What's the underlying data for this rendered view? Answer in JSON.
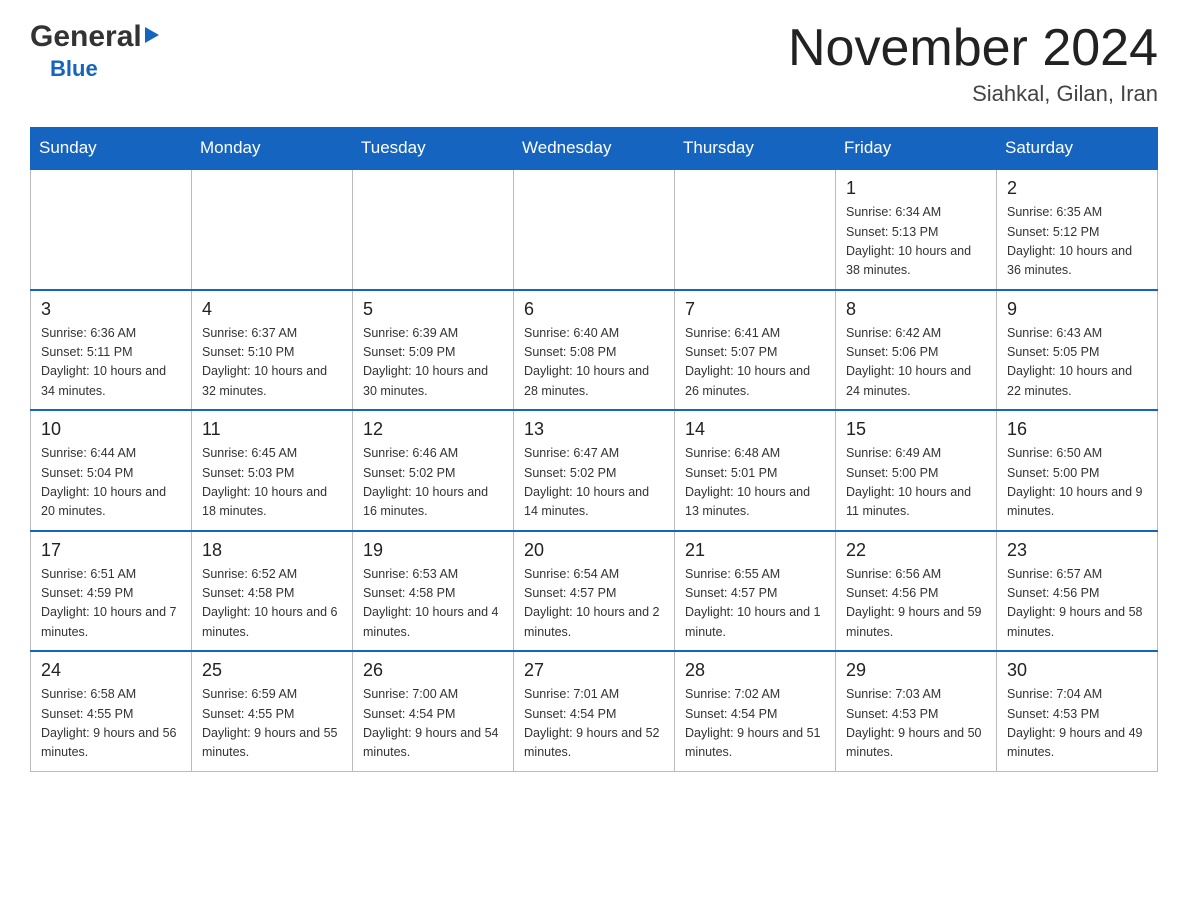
{
  "header": {
    "logo_general": "General",
    "logo_blue": "Blue",
    "month_title": "November 2024",
    "location": "Siahkal, Gilan, Iran"
  },
  "days_of_week": [
    "Sunday",
    "Monday",
    "Tuesday",
    "Wednesday",
    "Thursday",
    "Friday",
    "Saturday"
  ],
  "weeks": [
    {
      "days": [
        {
          "num": "",
          "info": ""
        },
        {
          "num": "",
          "info": ""
        },
        {
          "num": "",
          "info": ""
        },
        {
          "num": "",
          "info": ""
        },
        {
          "num": "",
          "info": ""
        },
        {
          "num": "1",
          "info": "Sunrise: 6:34 AM\nSunset: 5:13 PM\nDaylight: 10 hours\nand 38 minutes."
        },
        {
          "num": "2",
          "info": "Sunrise: 6:35 AM\nSunset: 5:12 PM\nDaylight: 10 hours\nand 36 minutes."
        }
      ]
    },
    {
      "days": [
        {
          "num": "3",
          "info": "Sunrise: 6:36 AM\nSunset: 5:11 PM\nDaylight: 10 hours\nand 34 minutes."
        },
        {
          "num": "4",
          "info": "Sunrise: 6:37 AM\nSunset: 5:10 PM\nDaylight: 10 hours\nand 32 minutes."
        },
        {
          "num": "5",
          "info": "Sunrise: 6:39 AM\nSunset: 5:09 PM\nDaylight: 10 hours\nand 30 minutes."
        },
        {
          "num": "6",
          "info": "Sunrise: 6:40 AM\nSunset: 5:08 PM\nDaylight: 10 hours\nand 28 minutes."
        },
        {
          "num": "7",
          "info": "Sunrise: 6:41 AM\nSunset: 5:07 PM\nDaylight: 10 hours\nand 26 minutes."
        },
        {
          "num": "8",
          "info": "Sunrise: 6:42 AM\nSunset: 5:06 PM\nDaylight: 10 hours\nand 24 minutes."
        },
        {
          "num": "9",
          "info": "Sunrise: 6:43 AM\nSunset: 5:05 PM\nDaylight: 10 hours\nand 22 minutes."
        }
      ]
    },
    {
      "days": [
        {
          "num": "10",
          "info": "Sunrise: 6:44 AM\nSunset: 5:04 PM\nDaylight: 10 hours\nand 20 minutes."
        },
        {
          "num": "11",
          "info": "Sunrise: 6:45 AM\nSunset: 5:03 PM\nDaylight: 10 hours\nand 18 minutes."
        },
        {
          "num": "12",
          "info": "Sunrise: 6:46 AM\nSunset: 5:02 PM\nDaylight: 10 hours\nand 16 minutes."
        },
        {
          "num": "13",
          "info": "Sunrise: 6:47 AM\nSunset: 5:02 PM\nDaylight: 10 hours\nand 14 minutes."
        },
        {
          "num": "14",
          "info": "Sunrise: 6:48 AM\nSunset: 5:01 PM\nDaylight: 10 hours\nand 13 minutes."
        },
        {
          "num": "15",
          "info": "Sunrise: 6:49 AM\nSunset: 5:00 PM\nDaylight: 10 hours\nand 11 minutes."
        },
        {
          "num": "16",
          "info": "Sunrise: 6:50 AM\nSunset: 5:00 PM\nDaylight: 10 hours\nand 9 minutes."
        }
      ]
    },
    {
      "days": [
        {
          "num": "17",
          "info": "Sunrise: 6:51 AM\nSunset: 4:59 PM\nDaylight: 10 hours\nand 7 minutes."
        },
        {
          "num": "18",
          "info": "Sunrise: 6:52 AM\nSunset: 4:58 PM\nDaylight: 10 hours\nand 6 minutes."
        },
        {
          "num": "19",
          "info": "Sunrise: 6:53 AM\nSunset: 4:58 PM\nDaylight: 10 hours\nand 4 minutes."
        },
        {
          "num": "20",
          "info": "Sunrise: 6:54 AM\nSunset: 4:57 PM\nDaylight: 10 hours\nand 2 minutes."
        },
        {
          "num": "21",
          "info": "Sunrise: 6:55 AM\nSunset: 4:57 PM\nDaylight: 10 hours\nand 1 minute."
        },
        {
          "num": "22",
          "info": "Sunrise: 6:56 AM\nSunset: 4:56 PM\nDaylight: 9 hours\nand 59 minutes."
        },
        {
          "num": "23",
          "info": "Sunrise: 6:57 AM\nSunset: 4:56 PM\nDaylight: 9 hours\nand 58 minutes."
        }
      ]
    },
    {
      "days": [
        {
          "num": "24",
          "info": "Sunrise: 6:58 AM\nSunset: 4:55 PM\nDaylight: 9 hours\nand 56 minutes."
        },
        {
          "num": "25",
          "info": "Sunrise: 6:59 AM\nSunset: 4:55 PM\nDaylight: 9 hours\nand 55 minutes."
        },
        {
          "num": "26",
          "info": "Sunrise: 7:00 AM\nSunset: 4:54 PM\nDaylight: 9 hours\nand 54 minutes."
        },
        {
          "num": "27",
          "info": "Sunrise: 7:01 AM\nSunset: 4:54 PM\nDaylight: 9 hours\nand 52 minutes."
        },
        {
          "num": "28",
          "info": "Sunrise: 7:02 AM\nSunset: 4:54 PM\nDaylight: 9 hours\nand 51 minutes."
        },
        {
          "num": "29",
          "info": "Sunrise: 7:03 AM\nSunset: 4:53 PM\nDaylight: 9 hours\nand 50 minutes."
        },
        {
          "num": "30",
          "info": "Sunrise: 7:04 AM\nSunset: 4:53 PM\nDaylight: 9 hours\nand 49 minutes."
        }
      ]
    }
  ]
}
